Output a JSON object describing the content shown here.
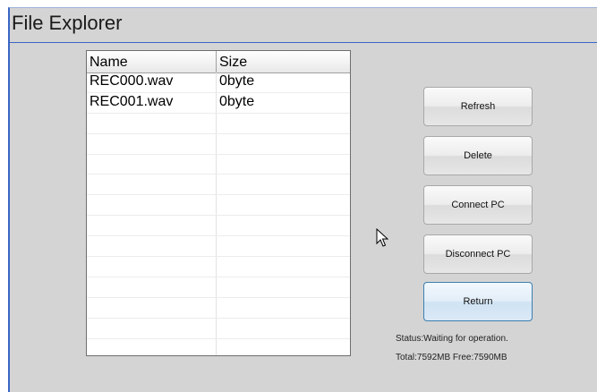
{
  "window": {
    "title": "File Explorer"
  },
  "table": {
    "headers": {
      "name": "Name",
      "size": "Size"
    },
    "rows": [
      {
        "name": "REC000.wav",
        "size": "0byte"
      },
      {
        "name": "REC001.wav",
        "size": "0byte"
      },
      {
        "name": "",
        "size": ""
      },
      {
        "name": "",
        "size": ""
      },
      {
        "name": "",
        "size": ""
      },
      {
        "name": "",
        "size": ""
      },
      {
        "name": "",
        "size": ""
      },
      {
        "name": "",
        "size": ""
      },
      {
        "name": "",
        "size": ""
      },
      {
        "name": "",
        "size": ""
      },
      {
        "name": "",
        "size": ""
      },
      {
        "name": "",
        "size": ""
      },
      {
        "name": "",
        "size": ""
      },
      {
        "name": "",
        "size": ""
      }
    ]
  },
  "buttons": {
    "refresh": "Refresh",
    "delete": "Delete",
    "connect_pc": "Connect PC",
    "disconnect_pc": "Disconnect PC",
    "return": "Return"
  },
  "status": {
    "message": "Status:Waiting for operation.",
    "storage": "Total:7592MB Free:7590MB"
  },
  "colors": {
    "window_bg": "#d4d4d4",
    "accent_border": "#3a66c4",
    "active_button_border": "#3c7fb1"
  },
  "icons": {
    "cursor": "arrow-cursor-icon"
  }
}
